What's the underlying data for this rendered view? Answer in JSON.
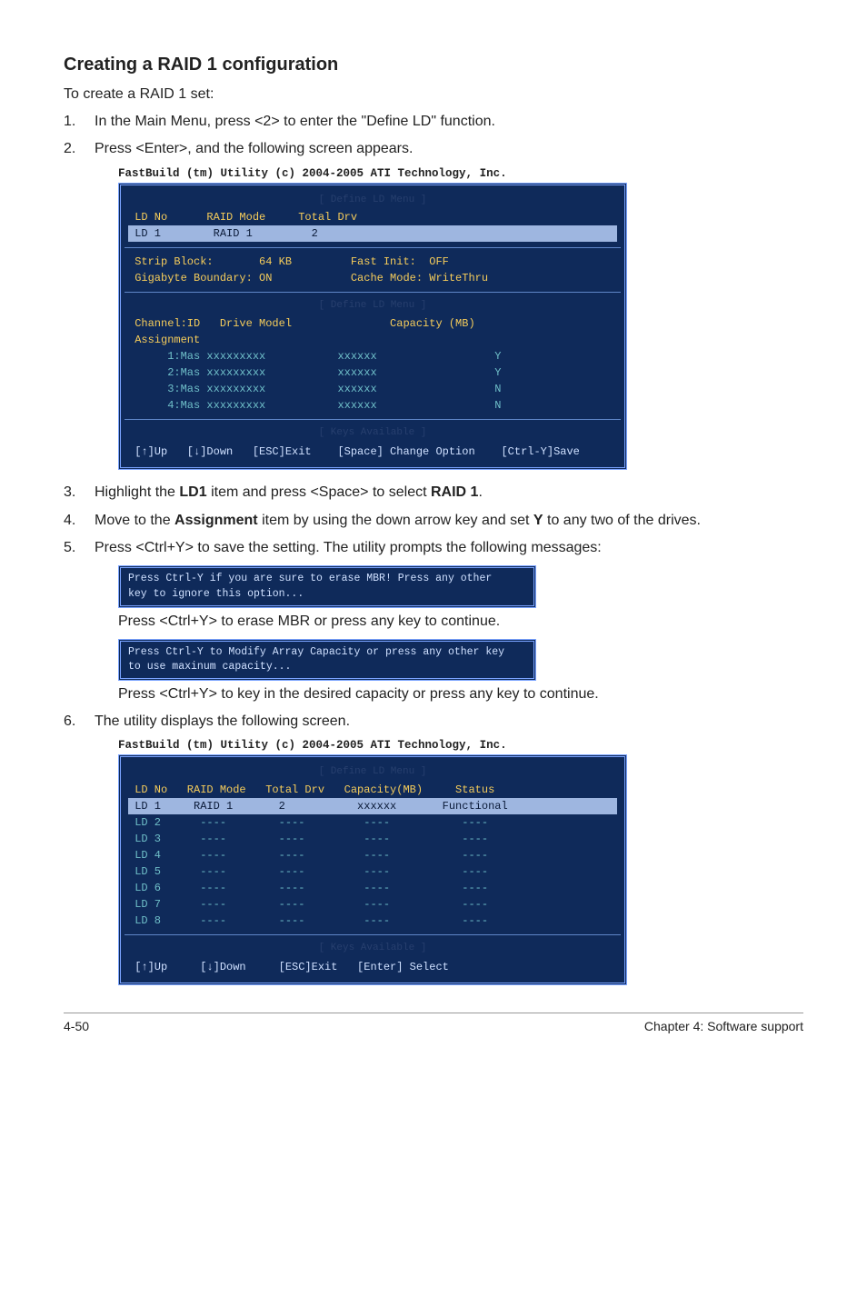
{
  "heading": "Creating a RAID 1 configuration",
  "intro": "To create a RAID 1 set:",
  "steps": {
    "s1": {
      "num": "1.",
      "text": "In the Main Menu, press <2> to enter the \"Define LD\" function."
    },
    "s2": {
      "num": "2.",
      "text": "Press <Enter>, and the following screen appears."
    },
    "s3": {
      "num": "3.",
      "text_a": "Highlight the ",
      "bold_a": "LD1",
      "text_b": " item and press <Space> to select ",
      "bold_b": "RAID 1",
      "text_c": "."
    },
    "s4": {
      "num": "4.",
      "text_a": "Move to the ",
      "bold_a": "Assignment",
      "text_b": " item by using the down arrow key and set ",
      "bold_b": "Y",
      "text_c": " to any two of the drives."
    },
    "s5": {
      "num": "5.",
      "text": "Press <Ctrl+Y> to save the setting. The utility prompts the following messages:"
    },
    "after_msg1": "Press <Ctrl+Y> to erase MBR or press any key to continue.",
    "after_msg2": "Press <Ctrl+Y> to key in the desired capacity or press any key to continue.",
    "s6": {
      "num": "6.",
      "text": "The utility displays the following screen."
    }
  },
  "bios1": {
    "title": "FastBuild (tm) Utility (c) 2004-2005 ATI Technology, Inc.",
    "label1": "[ Define LD Menu ]",
    "hdr1": " LD No      RAID Mode     Total Drv",
    "row1": " LD 1        RAID 1         2",
    "opt1": " Strip Block:       64 KB         Fast Init:  OFF",
    "opt2": " Gigabyte Boundary: ON            Cache Mode: WriteThru",
    "label2": "[ Define LD Menu ]",
    "hdr2": " Channel:ID   Drive Model               Capacity (MB)",
    "hdr2b": " Assignment",
    "d1": "      1:Mas xxxxxxxxx           xxxxxx                  Y",
    "d2": "      2:Mas xxxxxxxxx           xxxxxx                  Y",
    "d3": "      3:Mas xxxxxxxxx           xxxxxx                  N",
    "d4": "      4:Mas xxxxxxxxx           xxxxxx                  N",
    "label3": "[ Keys Available ]",
    "keys": " [↑]Up   [↓]Down   [ESC]Exit    [Space] Change Option    [Ctrl-Y]Save"
  },
  "msg1": {
    "l1": "Press Ctrl-Y if you are sure to erase MBR! Press any other",
    "l2": "key to ignore this option..."
  },
  "msg2": {
    "l1": "Press Ctrl-Y to Modify Array Capacity or press any other key",
    "l2": "to use maxinum capacity..."
  },
  "bios2": {
    "title": "FastBuild (tm) Utility (c) 2004-2005 ATI Technology, Inc.",
    "label1": "[ Define LD Menu ]",
    "hdr": " LD No   RAID Mode   Total Drv   Capacity(MB)     Status",
    "row1": " LD 1     RAID 1       2           xxxxxx       Functional",
    "r2": " LD 2      ----        ----         ----           ----",
    "r3": " LD 3      ----        ----         ----           ----",
    "r4": " LD 4      ----        ----         ----           ----",
    "r5": " LD 5      ----        ----         ----           ----",
    "r6": " LD 6      ----        ----         ----           ----",
    "r7": " LD 7      ----        ----         ----           ----",
    "r8": " LD 8      ----        ----         ----           ----",
    "label2": "[ Keys Available ]",
    "keys": " [↑]Up     [↓]Down     [ESC]Exit   [Enter] Select"
  },
  "footer": {
    "left": "4-50",
    "right": "Chapter 4: Software support"
  }
}
